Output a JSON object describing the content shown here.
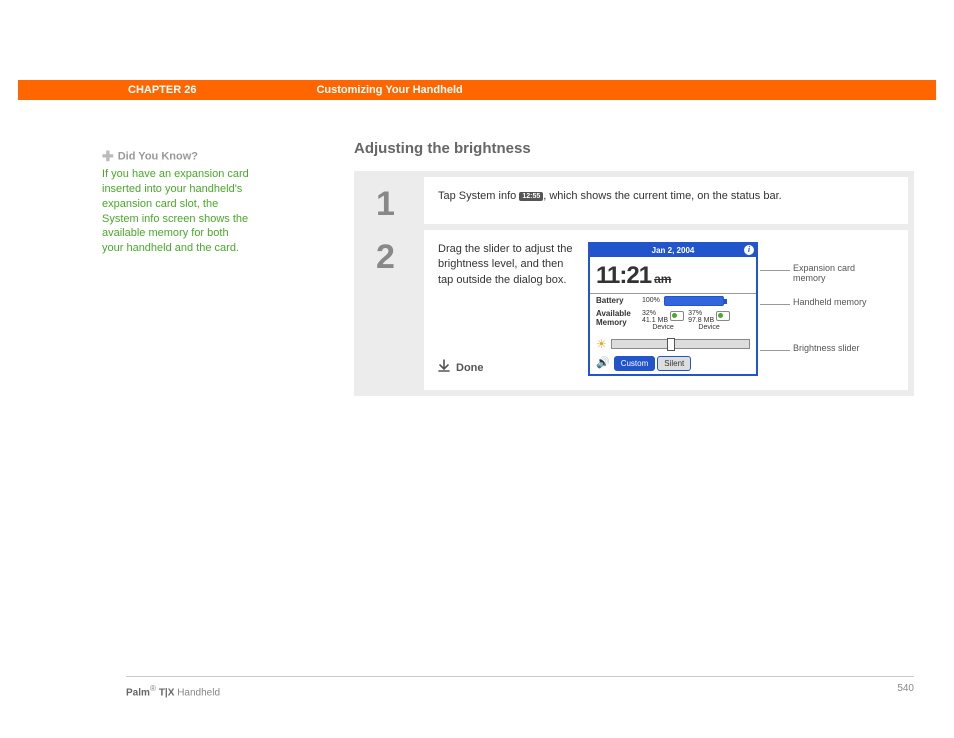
{
  "header": {
    "chapter": "CHAPTER 26",
    "title": "Customizing Your Handheld"
  },
  "sidebar": {
    "heading": "Did You Know?",
    "body": "If you have an expansion card inserted into your handheld's expansion card slot, the System info screen shows the available memory for both your handheld and the card."
  },
  "section_title": "Adjusting the brightness",
  "steps": [
    {
      "num": "1",
      "text_before": "Tap System info ",
      "pill": "12:55",
      "text_after": ", which shows the current time, on the status bar."
    },
    {
      "num": "2",
      "text": "Drag the slider to adjust the brightness level, and then tap outside the dialog box.",
      "done": "Done"
    }
  ],
  "device": {
    "date": "Jan 2, 2004",
    "time": "11:21",
    "ampm": "am",
    "battery_label": "Battery",
    "battery_pct": "100%",
    "mem_label": "Available Memory",
    "mem1_pct": "32%",
    "mem1_size": "41.1 MB",
    "mem1_name": "Device",
    "mem2_pct": "37%",
    "mem2_size": "97.8 MB",
    "mem2_name": "Device",
    "btn_custom": "Custom",
    "btn_silent": "Silent"
  },
  "callouts": {
    "c1": "Expansion card memory",
    "c2": "Handheld memory",
    "c3": "Brightness slider"
  },
  "footer": {
    "brand": "Palm",
    "model": "T|X",
    "suffix": "Handheld",
    "page": "540"
  }
}
